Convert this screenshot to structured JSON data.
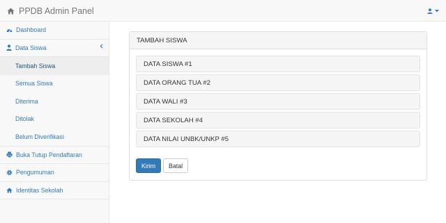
{
  "navbar": {
    "brand": "PPDB Admin Panel",
    "brand_icon": "home-icon",
    "user_icon": "user-icon"
  },
  "sidebar": {
    "items": [
      {
        "label": "Dashboard",
        "icon": "dashboard-icon"
      },
      {
        "label": "Data Siswa",
        "icon": "user-icon",
        "expanded": true
      },
      {
        "label": "Buka Tutup Pendaftaran",
        "icon": "print-icon"
      },
      {
        "label": "Pengumuman",
        "icon": "gear-icon"
      },
      {
        "label": "Identitas Sekolah",
        "icon": "home-icon"
      }
    ],
    "submenu": [
      {
        "label": "Tambah Siswa",
        "active": true
      },
      {
        "label": "Semua Siswa"
      },
      {
        "label": "Diterima"
      },
      {
        "label": "Ditolak"
      },
      {
        "label": "Belum Diverifikasi"
      }
    ]
  },
  "form": {
    "title": "TAMBAH SISWA",
    "sections": [
      "DATA SISWA #1",
      "DATA ORANG TUA #2",
      "DATA WALI #3",
      "DATA SEKOLAH #4",
      "DATA NILAI UNBK/UNKP #5"
    ],
    "submit_label": "Kirim",
    "cancel_label": "Batal"
  },
  "colors": {
    "primary": "#337ab7",
    "link": "#337ab7",
    "navbar_bg": "#f8f8f8",
    "active_bg": "#eeeeee"
  }
}
